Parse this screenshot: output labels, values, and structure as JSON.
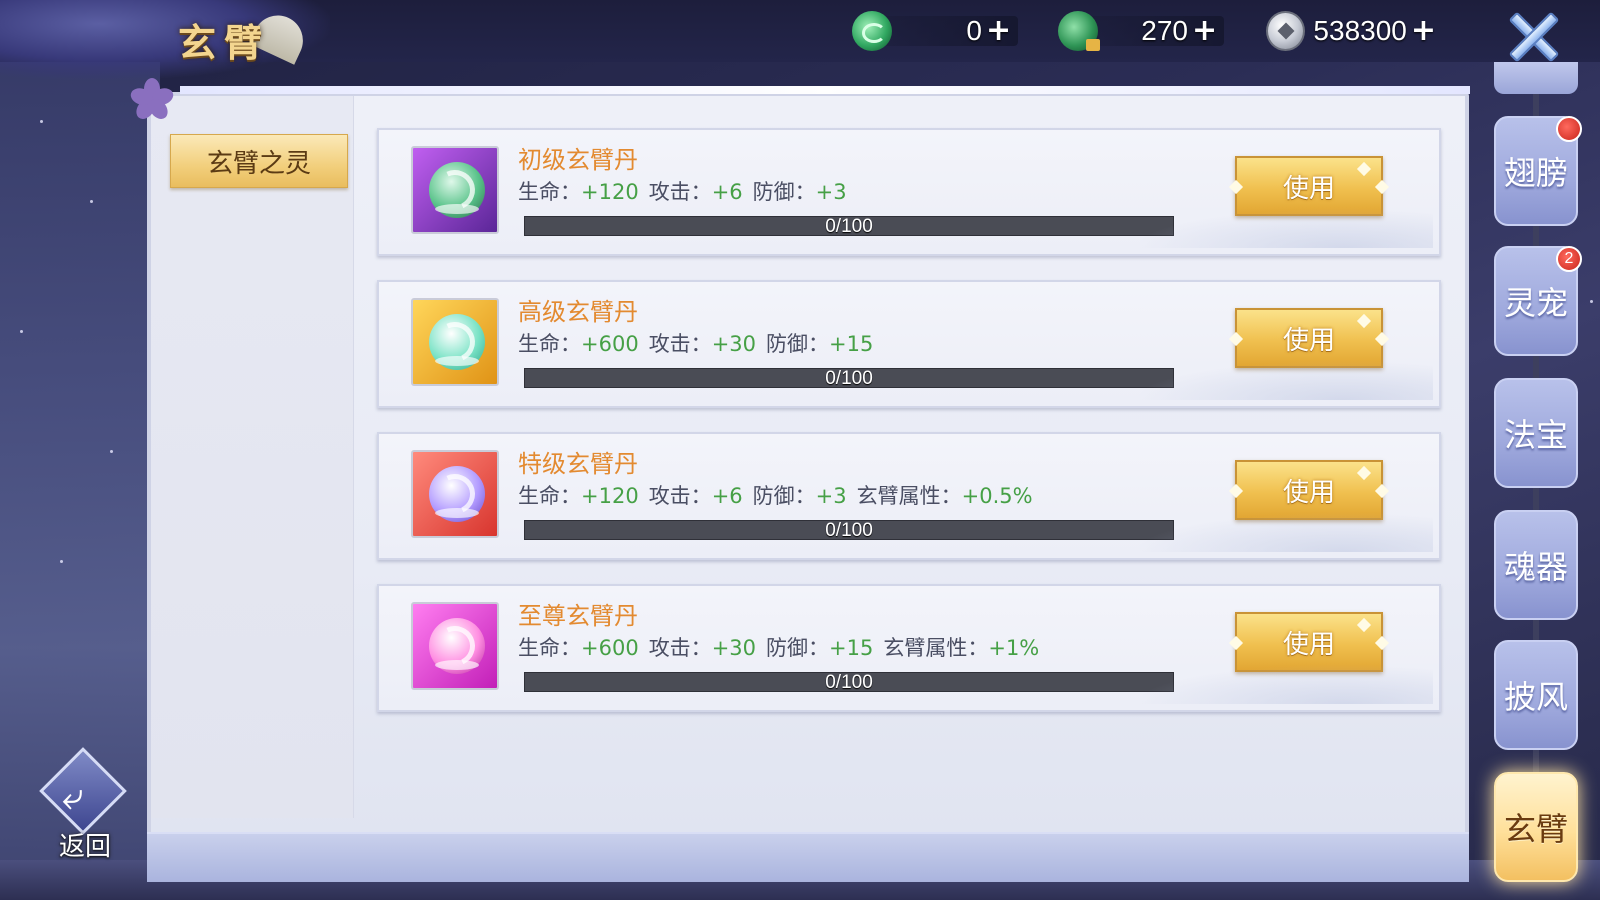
{
  "header": {
    "title": "玄臂"
  },
  "currencies": [
    {
      "icon": "jade-icon",
      "value": "0"
    },
    {
      "icon": "bound-jade-icon",
      "value": "270"
    },
    {
      "icon": "silver-coin-icon",
      "value": "538300"
    }
  ],
  "tabs": [
    {
      "label": "玄臂之灵"
    }
  ],
  "items": [
    {
      "name": "初级玄臂丹",
      "stats": [
        {
          "label": "生命：",
          "value": "+120"
        },
        {
          "label": "攻击：",
          "value": "+6"
        },
        {
          "label": "防御：",
          "value": "+3"
        }
      ],
      "progress_text": "0/100",
      "progress_fraction": 0,
      "button": "使用",
      "icon_color": "#7a3fb8"
    },
    {
      "name": "高级玄臂丹",
      "stats": [
        {
          "label": "生命：",
          "value": "+600"
        },
        {
          "label": "攻击：",
          "value": "+30"
        },
        {
          "label": "防御：",
          "value": "+15"
        }
      ],
      "progress_text": "0/100",
      "progress_fraction": 0,
      "button": "使用",
      "icon_color": "#e6a321"
    },
    {
      "name": "特级玄臂丹",
      "stats": [
        {
          "label": "生命：",
          "value": "+120"
        },
        {
          "label": "攻击：",
          "value": "+6"
        },
        {
          "label": "防御：",
          "value": "+3"
        },
        {
          "label": "玄臂属性：",
          "value": "+0.5%"
        }
      ],
      "progress_text": "0/100",
      "progress_fraction": 0,
      "button": "使用",
      "icon_color": "#e0473d"
    },
    {
      "name": "至尊玄臂丹",
      "stats": [
        {
          "label": "生命：",
          "value": "+600"
        },
        {
          "label": "攻击：",
          "value": "+30"
        },
        {
          "label": "防御：",
          "value": "+15"
        },
        {
          "label": "玄臂属性：",
          "value": "+1%"
        }
      ],
      "progress_text": "0/100",
      "progress_fraction": 0,
      "button": "使用",
      "icon_color": "#e23fc8"
    }
  ],
  "sidenav": [
    {
      "label": "翅膀",
      "badge": "",
      "active": false
    },
    {
      "label": "灵宠",
      "badge": "2",
      "active": false
    },
    {
      "label": "法宝",
      "badge": "",
      "active": false
    },
    {
      "label": "魂器",
      "badge": "",
      "active": false
    },
    {
      "label": "披风",
      "badge": "",
      "active": false
    },
    {
      "label": "玄臂",
      "badge": "",
      "active": true
    }
  ],
  "back_button": {
    "label": "返回"
  },
  "colors": {
    "accent_gold": "#f0c04f",
    "stat_green": "#46a046",
    "item_name_orange": "#e38a30"
  }
}
